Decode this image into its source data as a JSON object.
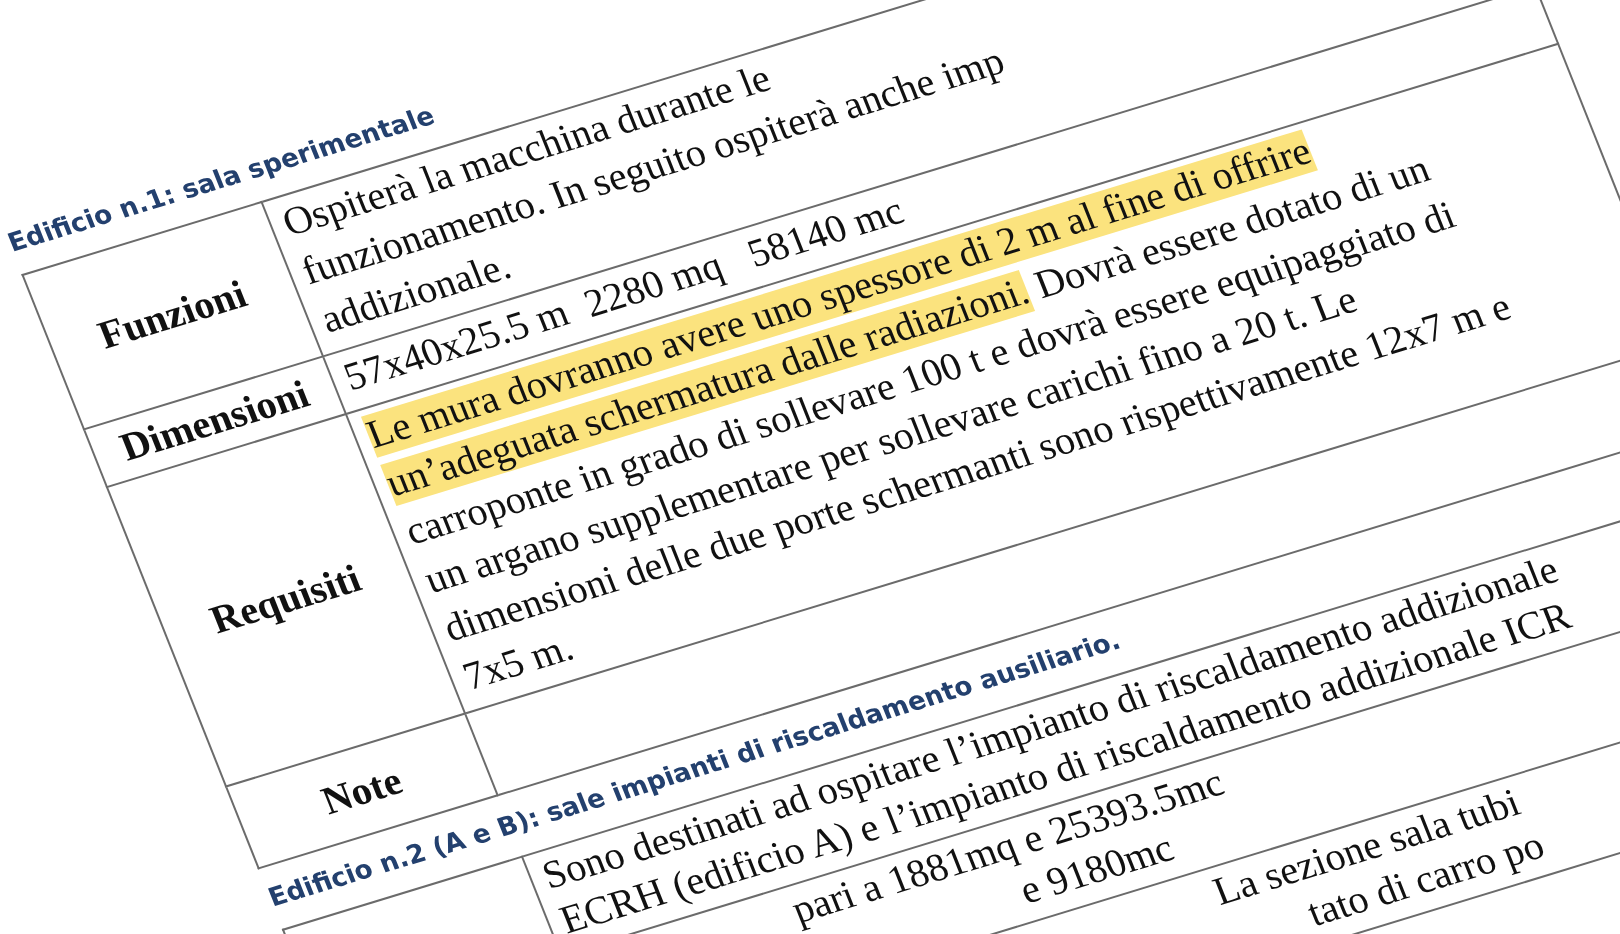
{
  "sections": [
    {
      "heading": "Edificio n.1: sala sperimentale",
      "rows": [
        {
          "label": "Funzioni",
          "lines": [
            {
              "segments": [
                {
                  "text": "Ospiterà la macchina durante le",
                  "kind": "plain"
                }
              ]
            },
            {
              "segments": [
                {
                  "text": "funzionamento. In seguito ospiterà anche imp",
                  "kind": "plain"
                }
              ]
            },
            {
              "segments": [
                {
                  "text": "addizionale.",
                  "kind": "plain"
                }
              ]
            }
          ]
        },
        {
          "label": "Dimensioni",
          "lines": [
            {
              "segments": [
                {
                  "text": "57x40x25.5 m  2280 mq   58140 mc",
                  "kind": "plain"
                }
              ]
            }
          ]
        },
        {
          "label": "Requisiti",
          "lines": [
            {
              "segments": [
                {
                  "text": "Le mura dovranno avere uno spessore di 2 m al fine di offrire",
                  "kind": "highlight"
                }
              ]
            },
            {
              "segments": [
                {
                  "text": "un’adeguata schermatura dalle radiazioni.",
                  "kind": "highlight"
                },
                {
                  "text": " Dovrà essere dotato di un",
                  "kind": "plain"
                }
              ]
            },
            {
              "segments": [
                {
                  "text": "carroponte in grado di sollevare 100 t e dovrà essere equipaggiato di",
                  "kind": "plain"
                }
              ]
            },
            {
              "segments": [
                {
                  "text": "un argano supplementare per sollevare carichi fino a 20 t. Le",
                  "kind": "plain"
                }
              ]
            },
            {
              "segments": [
                {
                  "text": "dimensioni delle due porte schermanti sono rispettivamente 12x7 m e",
                  "kind": "plain"
                }
              ]
            },
            {
              "segments": [
                {
                  "text": "7x5 m.",
                  "kind": "plain"
                }
              ]
            }
          ]
        },
        {
          "label": "Note",
          "lines": []
        }
      ]
    },
    {
      "heading": "Edificio n.2 (A e B): sale impianti di riscaldamento ausiliario.",
      "rows": [
        {
          "lines": [
            {
              "segments": [
                {
                  "text": "Sono destinati ad ospitare l’impianto di riscaldamento addizionale",
                  "kind": "plain"
                }
              ]
            },
            {
              "segments": [
                {
                  "text": "ECRH (edificio A) e l’impianto di riscaldamento addizionale ICR",
                  "kind": "plain"
                }
              ]
            }
          ]
        },
        {
          "lines": [
            {
              "segments": [
                {
                  "text": "pari a 1881mq e 25393.5mc",
                  "kind": "plain"
                }
              ]
            },
            {
              "segments": [
                {
                  "text": "e 9180mc",
                  "kind": "plain"
                }
              ]
            }
          ]
        },
        {
          "lines": [
            {
              "segments": [
                {
                  "text": "La sezione sala tubi",
                  "kind": "plain"
                }
              ]
            },
            {
              "segments": [
                {
                  "text": "tato di carro po",
                  "kind": "plain"
                }
              ]
            }
          ]
        }
      ]
    }
  ]
}
